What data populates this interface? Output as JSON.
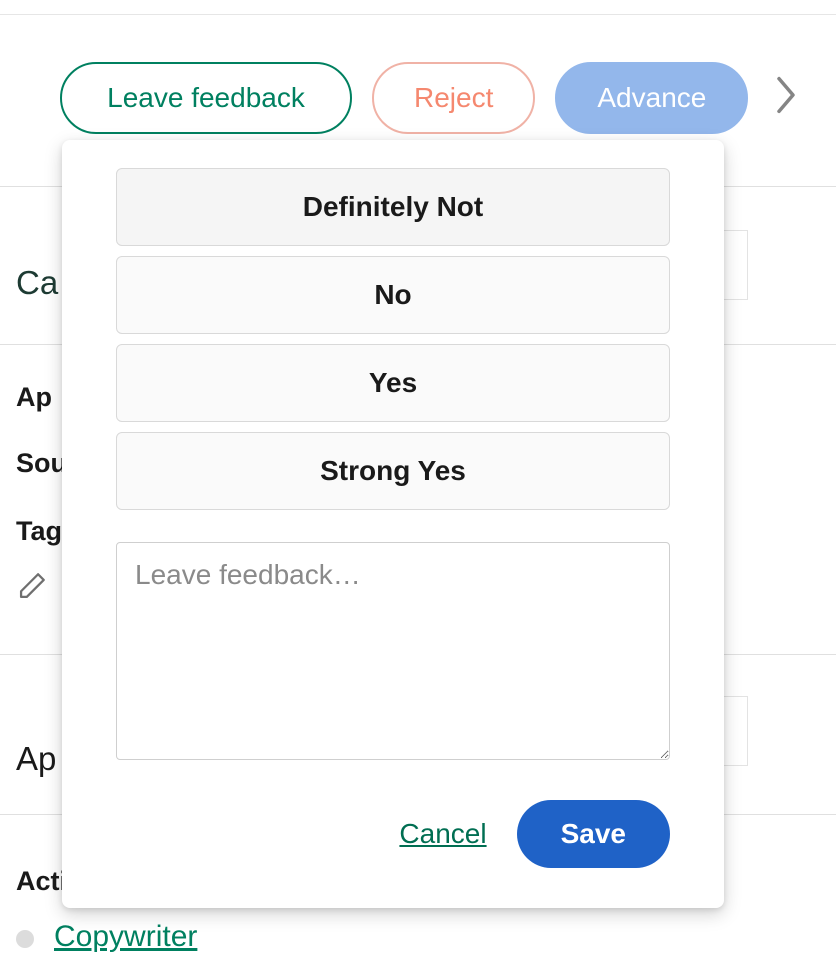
{
  "action_bar": {
    "leave_feedback_label": "Leave feedback",
    "reject_label": "Reject",
    "advance_label": "Advance"
  },
  "feedback_popover": {
    "options": [
      "Definitely Not",
      "No",
      "Yes",
      "Strong Yes"
    ],
    "textarea_placeholder": "Leave feedback…",
    "cancel_label": "Cancel",
    "save_label": "Save"
  },
  "background": {
    "section_can_prefix": "Ca",
    "labels": {
      "app": "Ap",
      "sou": "Sou",
      "tag": "Tag"
    },
    "section_app_prefix": "Ap",
    "activity_prefix": "Acti",
    "copywriter_link": "Copywriter"
  }
}
